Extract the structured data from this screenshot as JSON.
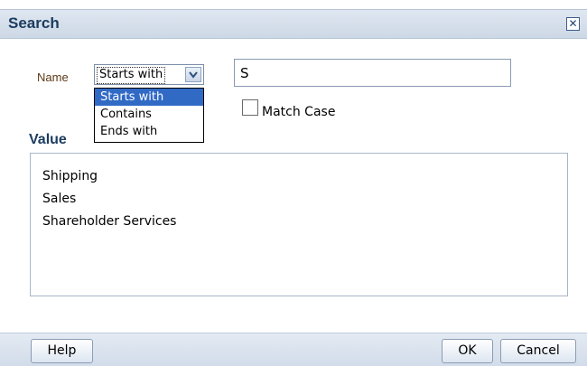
{
  "dialog": {
    "title": "Search",
    "close_icon": "close-icon"
  },
  "name_field": {
    "label": "Name",
    "selected": "Starts with",
    "options": [
      "Starts with",
      "Contains",
      "Ends with"
    ],
    "search_value": "S"
  },
  "match_case": {
    "label": "Match Case",
    "checked": false
  },
  "value_section": {
    "heading": "Value",
    "items": [
      "Shipping",
      "Sales",
      "Shareholder Services"
    ]
  },
  "footer": {
    "help_label": "Help",
    "ok_label": "OK",
    "cancel_label": "Cancel"
  },
  "colors": {
    "highlight": "#316ac5",
    "title_text": "#1c3c60"
  }
}
